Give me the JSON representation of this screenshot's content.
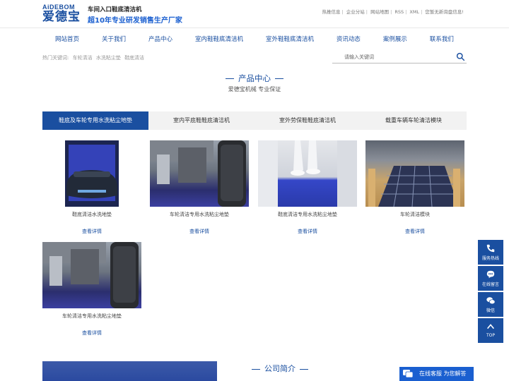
{
  "header": {
    "logo_en": "AiDEBOM",
    "logo_cn": "爱德宝",
    "slogan_main": "车间入口鞋底清洁机",
    "slogan_sub": "超10年专业研发销售生产厂家",
    "links": [
      "热推信息",
      "企业分站",
      "网站地图",
      "RSS",
      "XML",
      "您暂无新询盘信息!"
    ]
  },
  "nav": [
    "网站首页",
    "关于我们",
    "产品中心",
    "室内鞋鞋底清洁机",
    "室外鞋鞋底清洁机",
    "资讯动态",
    "案例展示",
    "联系我们"
  ],
  "hotwords": {
    "label": "热门关键词:",
    "items": [
      "车轮清洁",
      "水洗粘尘垫",
      "鞋底清洁"
    ]
  },
  "search": {
    "placeholder": "请输入关键词",
    "icon": "search-icon"
  },
  "section": {
    "title": "产品中心",
    "subtitle": "爱德宝机械 专业保证"
  },
  "tabs": [
    {
      "label": "鞋底及车轮专用水洗粘尘地垫",
      "active": true
    },
    {
      "label": "室内平底鞋鞋底清洁机",
      "active": false
    },
    {
      "label": "室外劳保鞋鞋底清洁机",
      "active": false
    },
    {
      "label": "载重车辆车轮清洁模块",
      "active": false
    }
  ],
  "products": [
    {
      "name": "鞋底清洁水洗地垫",
      "more": "查看详情"
    },
    {
      "name": "车轮清洁专用水洗粘尘地垫",
      "more": "查看详情"
    },
    {
      "name": "鞋底清洁专用水洗粘尘地垫",
      "more": "查看详情"
    },
    {
      "name": "车轮清洁模块",
      "more": "查看详情"
    },
    {
      "name": "车轮清洁专用水洗粘尘地垫",
      "more": "查看详情"
    }
  ],
  "intro": {
    "title": "公司简介"
  },
  "sidebar": [
    {
      "label": "服务热线",
      "icon": "phone-icon"
    },
    {
      "label": "在线留言",
      "icon": "message-icon"
    },
    {
      "label": "微信",
      "icon": "wechat-icon"
    },
    {
      "label": "TOP",
      "icon": "arrow-up-icon"
    }
  ],
  "chat": {
    "label": "在线客服 为您解答",
    "icon": "chat-icon"
  },
  "colors": {
    "brand": "#1a4fa0",
    "accent": "#1a5fd0"
  }
}
